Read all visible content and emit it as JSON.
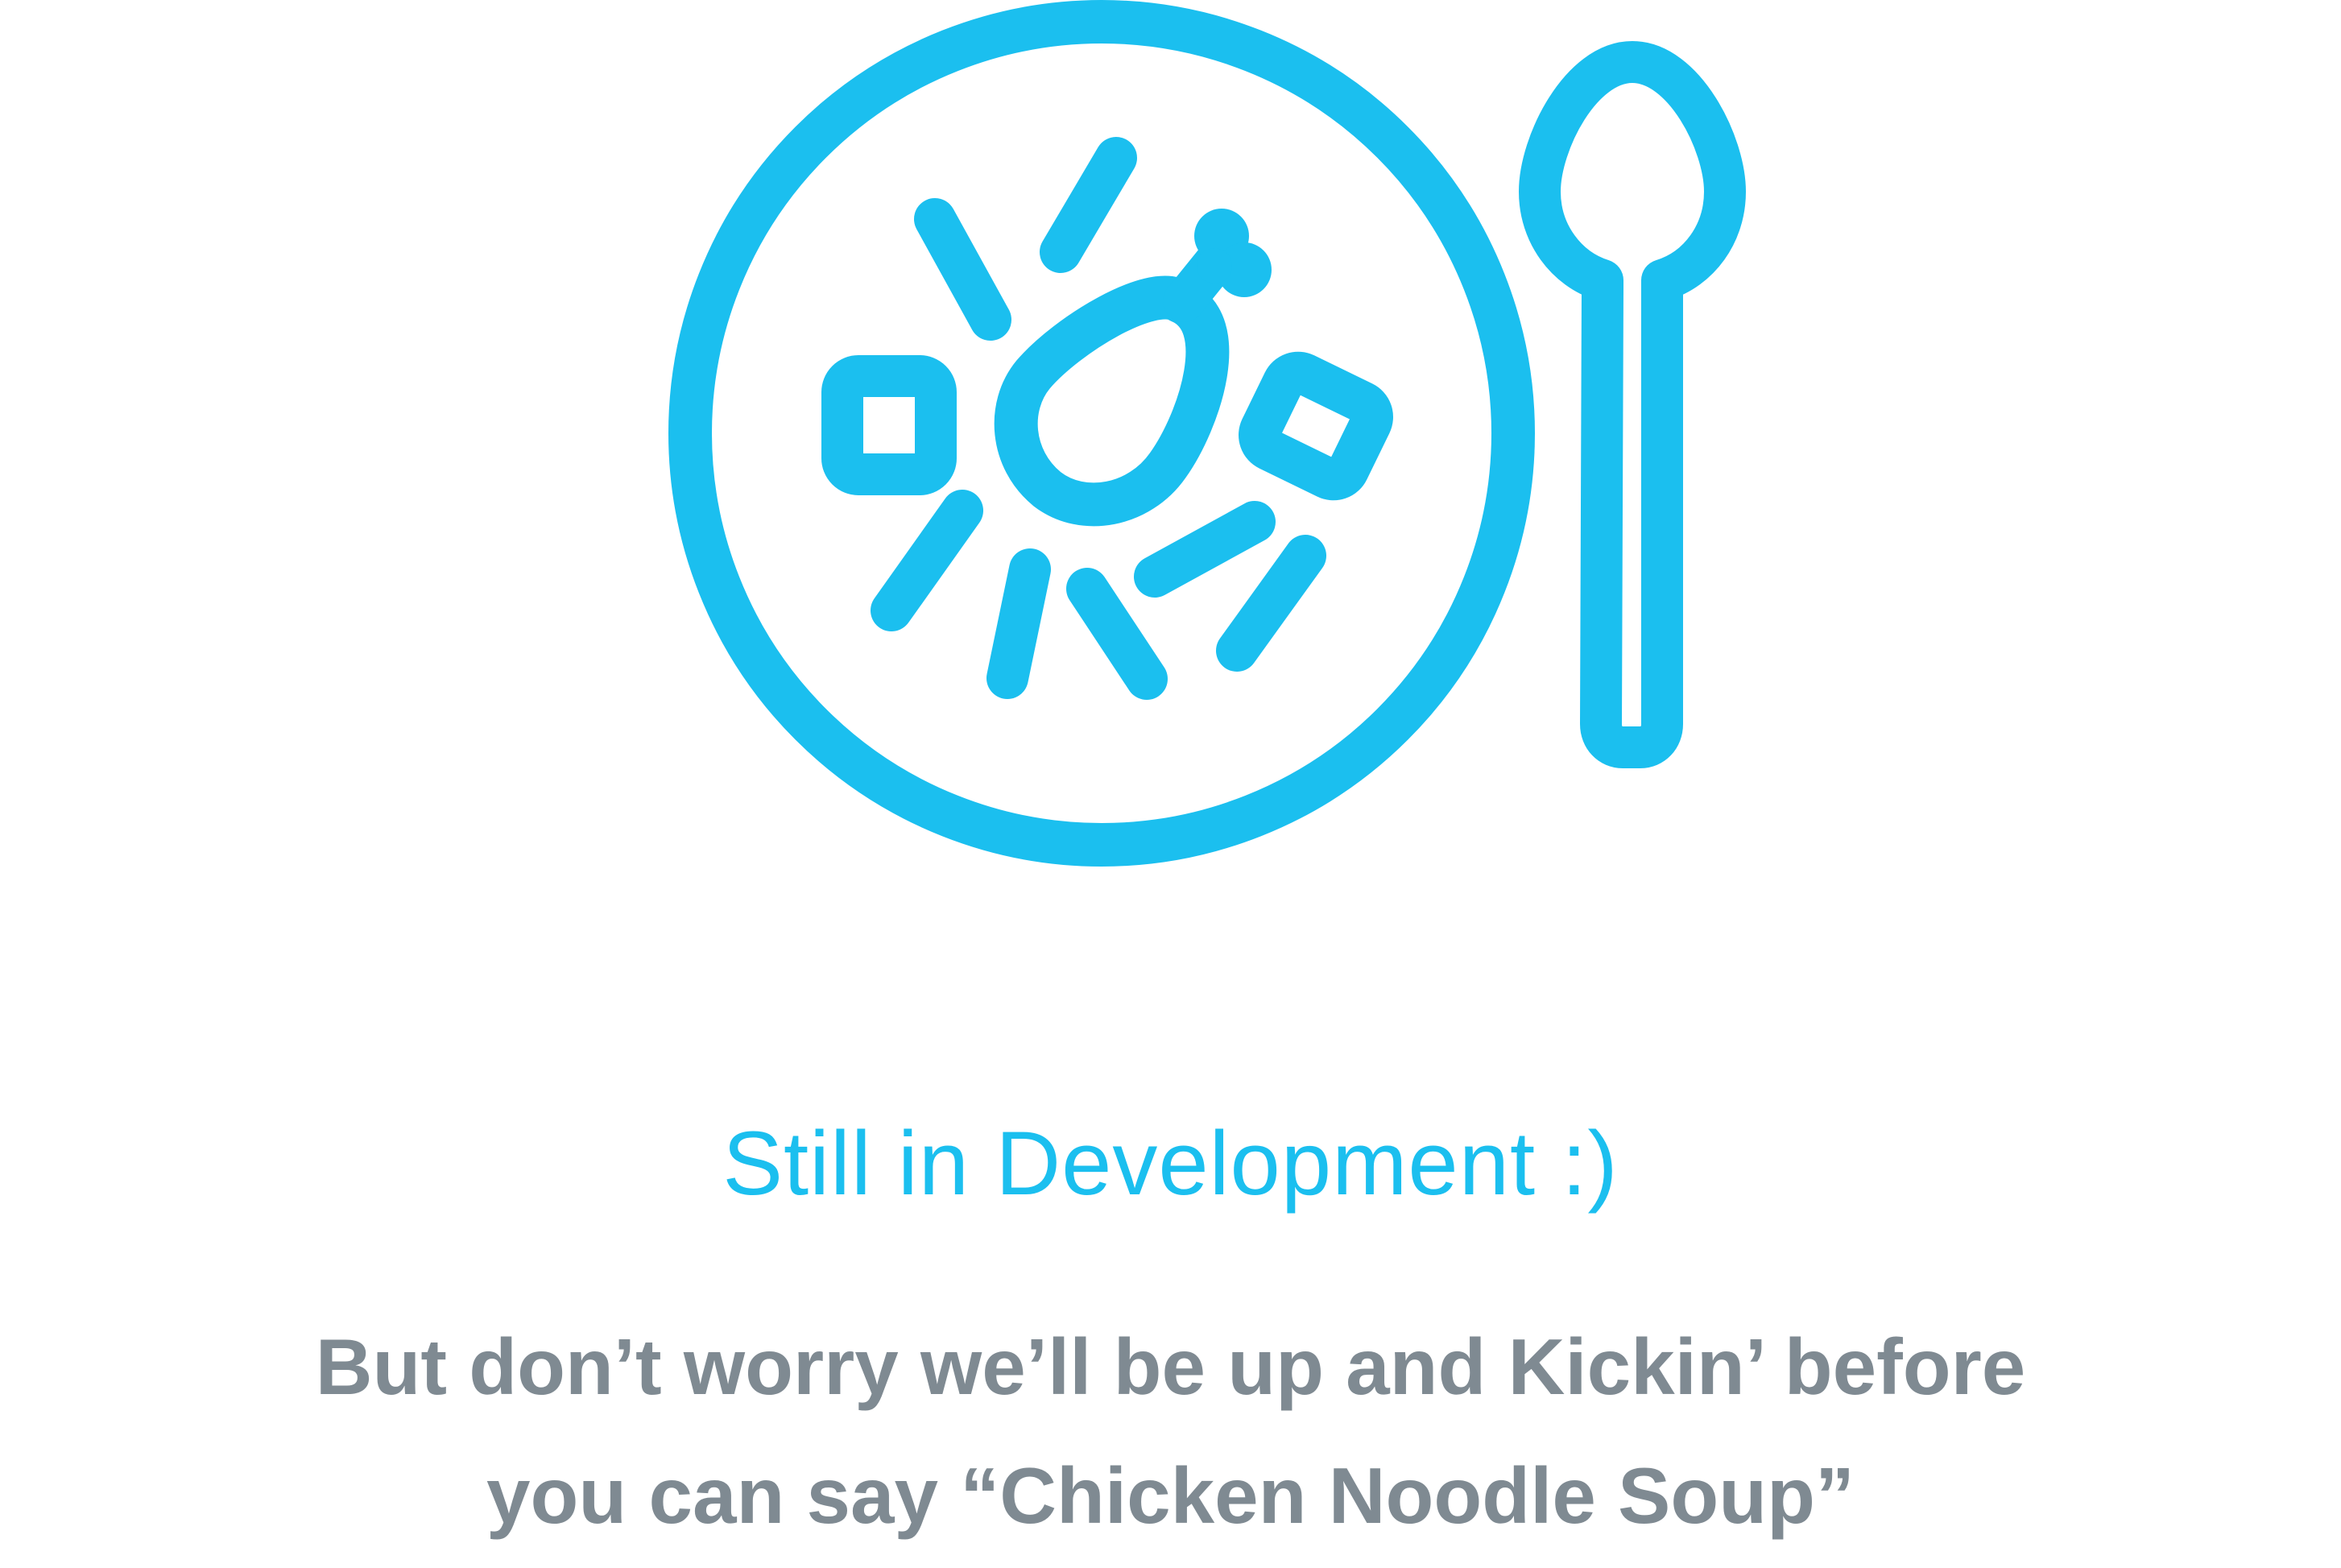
{
  "colors": {
    "accent": "#1BBFEF",
    "text_gray": "#7F8A92",
    "background": "#FFFFFF"
  },
  "illustration": {
    "icons": [
      "plate-icon",
      "chicken-drumstick-icon",
      "spoon-icon",
      "square-noodle-icon",
      "rotated-square-noodle-icon",
      "noodle-strand-icon"
    ]
  },
  "message": {
    "title": "Still in Development :)",
    "subtitle_line1": "But don’t worry we’ll be up and Kickin’ before",
    "subtitle_line2": "you can say “Chicken Noodle Soup”"
  }
}
